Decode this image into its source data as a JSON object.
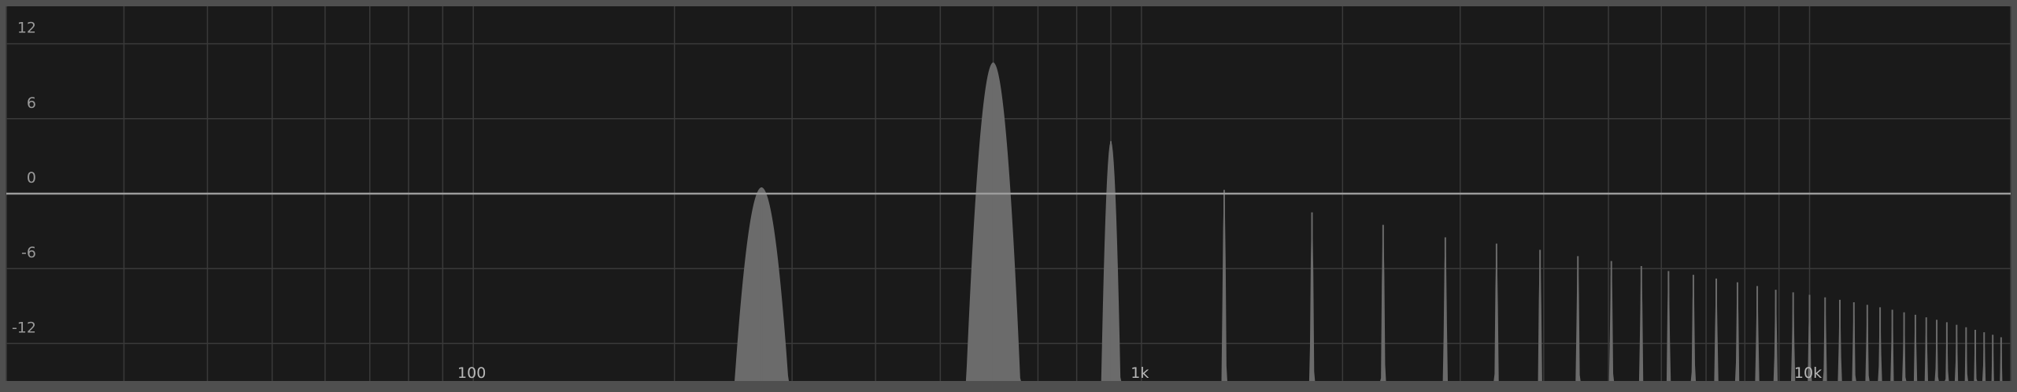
{
  "chart_data": {
    "type": "area",
    "title": "",
    "xlabel": "",
    "ylabel": "",
    "x_scale": "log",
    "xlim": [
      20,
      20000
    ],
    "ylim": [
      -15,
      15
    ],
    "y_ticks": [
      12,
      6,
      0,
      -6,
      -12
    ],
    "y_tick_labels": [
      "12",
      "6",
      "0",
      "-6",
      "-12"
    ],
    "x_tick_labels": [
      {
        "value": 100,
        "label": "100"
      },
      {
        "value": 1000,
        "label": "1k"
      },
      {
        "value": 10000,
        "label": "10k"
      }
    ],
    "grid": true,
    "colors": {
      "frame": "#4f4f4f",
      "plot_bg": "#1a1a1a",
      "grid": "#3a3a3a",
      "zero_line": "#9c9c9c",
      "spectrum_fill": "#6b6b6b"
    },
    "series": [
      {
        "peaks": [
          {
            "freq": 270,
            "db": 0.5
          },
          {
            "freq": 600,
            "db": 10.5
          },
          {
            "freq": 900,
            "db": 4.2
          },
          {
            "freq": 1330,
            "db": 0.3
          },
          {
            "freq": 1800,
            "db": -1.5
          },
          {
            "freq": 2300,
            "db": -2.5
          },
          {
            "freq": 2850,
            "db": -3.5
          },
          {
            "freq": 3400,
            "db": -4.0
          },
          {
            "freq": 3950,
            "db": -4.5
          },
          {
            "freq": 4500,
            "db": -5.0
          },
          {
            "freq": 5050,
            "db": -5.4
          },
          {
            "freq": 5600,
            "db": -5.8
          },
          {
            "freq": 6150,
            "db": -6.2
          },
          {
            "freq": 6700,
            "db": -6.5
          },
          {
            "freq": 7250,
            "db": -6.8
          },
          {
            "freq": 7800,
            "db": -7.1
          },
          {
            "freq": 8350,
            "db": -7.4
          },
          {
            "freq": 8900,
            "db": -7.7
          },
          {
            "freq": 9450,
            "db": -7.9
          },
          {
            "freq": 10000,
            "db": -8.1
          },
          {
            "freq": 10550,
            "db": -8.3
          },
          {
            "freq": 11100,
            "db": -8.5
          },
          {
            "freq": 11650,
            "db": -8.7
          },
          {
            "freq": 12200,
            "db": -8.9
          },
          {
            "freq": 12750,
            "db": -9.1
          },
          {
            "freq": 13300,
            "db": -9.3
          },
          {
            "freq": 13850,
            "db": -9.5
          },
          {
            "freq": 14400,
            "db": -9.7
          },
          {
            "freq": 14950,
            "db": -9.9
          },
          {
            "freq": 15500,
            "db": -10.1
          },
          {
            "freq": 16050,
            "db": -10.3
          },
          {
            "freq": 16600,
            "db": -10.5
          },
          {
            "freq": 17150,
            "db": -10.7
          },
          {
            "freq": 17700,
            "db": -10.9
          },
          {
            "freq": 18250,
            "db": -11.1
          },
          {
            "freq": 18800,
            "db": -11.3
          },
          {
            "freq": 19350,
            "db": -11.5
          }
        ]
      }
    ]
  }
}
